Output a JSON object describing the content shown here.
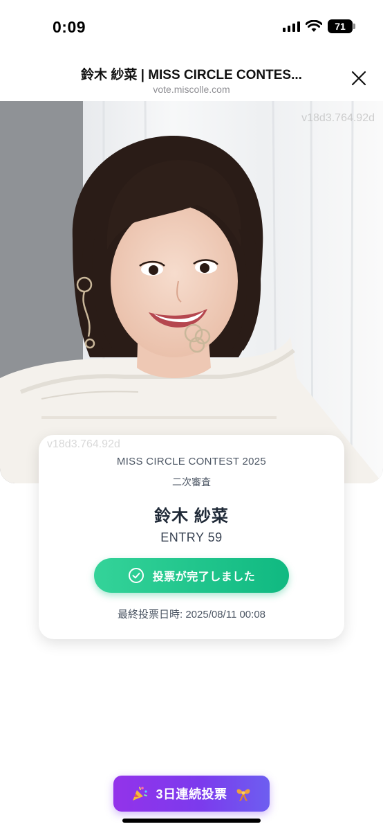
{
  "status_bar": {
    "time": "0:09",
    "battery": "71"
  },
  "browser": {
    "title": "鈴木 紗菜 | MISS CIRCLE CONTES...",
    "url": "vote.miscolle.com"
  },
  "photo": {
    "watermark": "v18d3.764.92d"
  },
  "card": {
    "contest": "MISS CIRCLE CONTEST 2025",
    "stage": "二次審査",
    "name": "鈴木 紗菜",
    "entry": "ENTRY 59",
    "vote_button_label": "投票が完了しました",
    "last_vote": "最終投票日時: 2025/08/11 00:08"
  },
  "streak": {
    "label": "3日連続投票"
  },
  "colors": {
    "vote_green": "#10b981",
    "streak_purple": "#7c3aed"
  },
  "icons": [
    "signal-icon",
    "wifi-icon",
    "battery-icon",
    "close-icon",
    "check-circle-icon",
    "party-popper-icon",
    "ribbon-gift-icon"
  ]
}
